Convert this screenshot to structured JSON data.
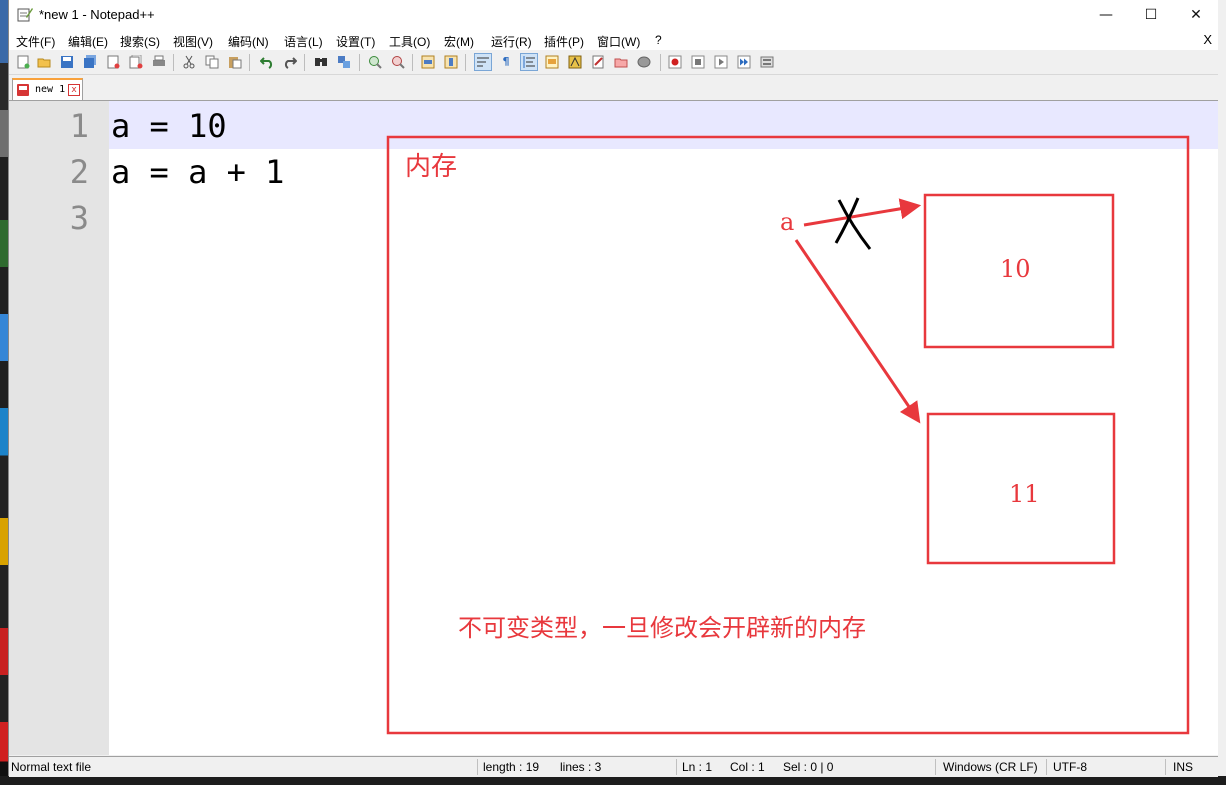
{
  "window": {
    "title": "*new 1 - Notepad++",
    "min_glyph": "—",
    "max_glyph": "☐",
    "close_glyph": "✕"
  },
  "menu": {
    "items": [
      "文件(F)",
      "编辑(E)",
      "搜索(S)",
      "视图(V)",
      "编码(N)",
      "语言(L)",
      "设置(T)",
      "工具(O)",
      "宏(M)",
      "运行(R)",
      "插件(P)",
      "窗口(W)",
      "?"
    ],
    "close": "X"
  },
  "toolbar": {
    "icons": [
      "new-file-icon",
      "open-file-icon",
      "save-icon",
      "save-all-icon",
      "close-icon",
      "close-all-icon",
      "print-icon",
      "cut-icon",
      "copy-icon",
      "paste-icon",
      "undo-icon",
      "redo-icon",
      "find-icon",
      "replace-icon",
      "zoom-in-icon",
      "zoom-out-icon",
      "sync-vertical-icon",
      "sync-horizontal-icon",
      "word-wrap-icon",
      "show-all-chars-icon",
      "indent-guide-icon",
      "user-lang-icon",
      "doc-map-icon",
      "function-list-icon",
      "folder-workspace-icon",
      "monitor-icon",
      "record-macro-icon",
      "stop-macro-icon",
      "play-macro-icon",
      "run-macro-multiple-icon",
      "save-macro-icon"
    ]
  },
  "tab": {
    "label": "new 1",
    "close_glyph": "x"
  },
  "editor": {
    "line_numbers": [
      "1",
      "2",
      "3"
    ],
    "lines": [
      "a = 10",
      "a = a + 1",
      ""
    ]
  },
  "annotation": {
    "memory_label": "内存",
    "var_label": "a",
    "box_old_value": "10",
    "box_new_value": "11",
    "caption": "不可变类型，一旦修改会开辟新的内存",
    "cross_mark": "X",
    "color": "#e8383d"
  },
  "status": {
    "file_type": "Normal text file",
    "length": "length : 19",
    "lines": "lines : 3",
    "ln": "Ln : 1",
    "col": "Col : 1",
    "sel": "Sel : 0 | 0",
    "eol": "Windows (CR LF)",
    "encoding": "UTF-8",
    "mode": "INS"
  }
}
